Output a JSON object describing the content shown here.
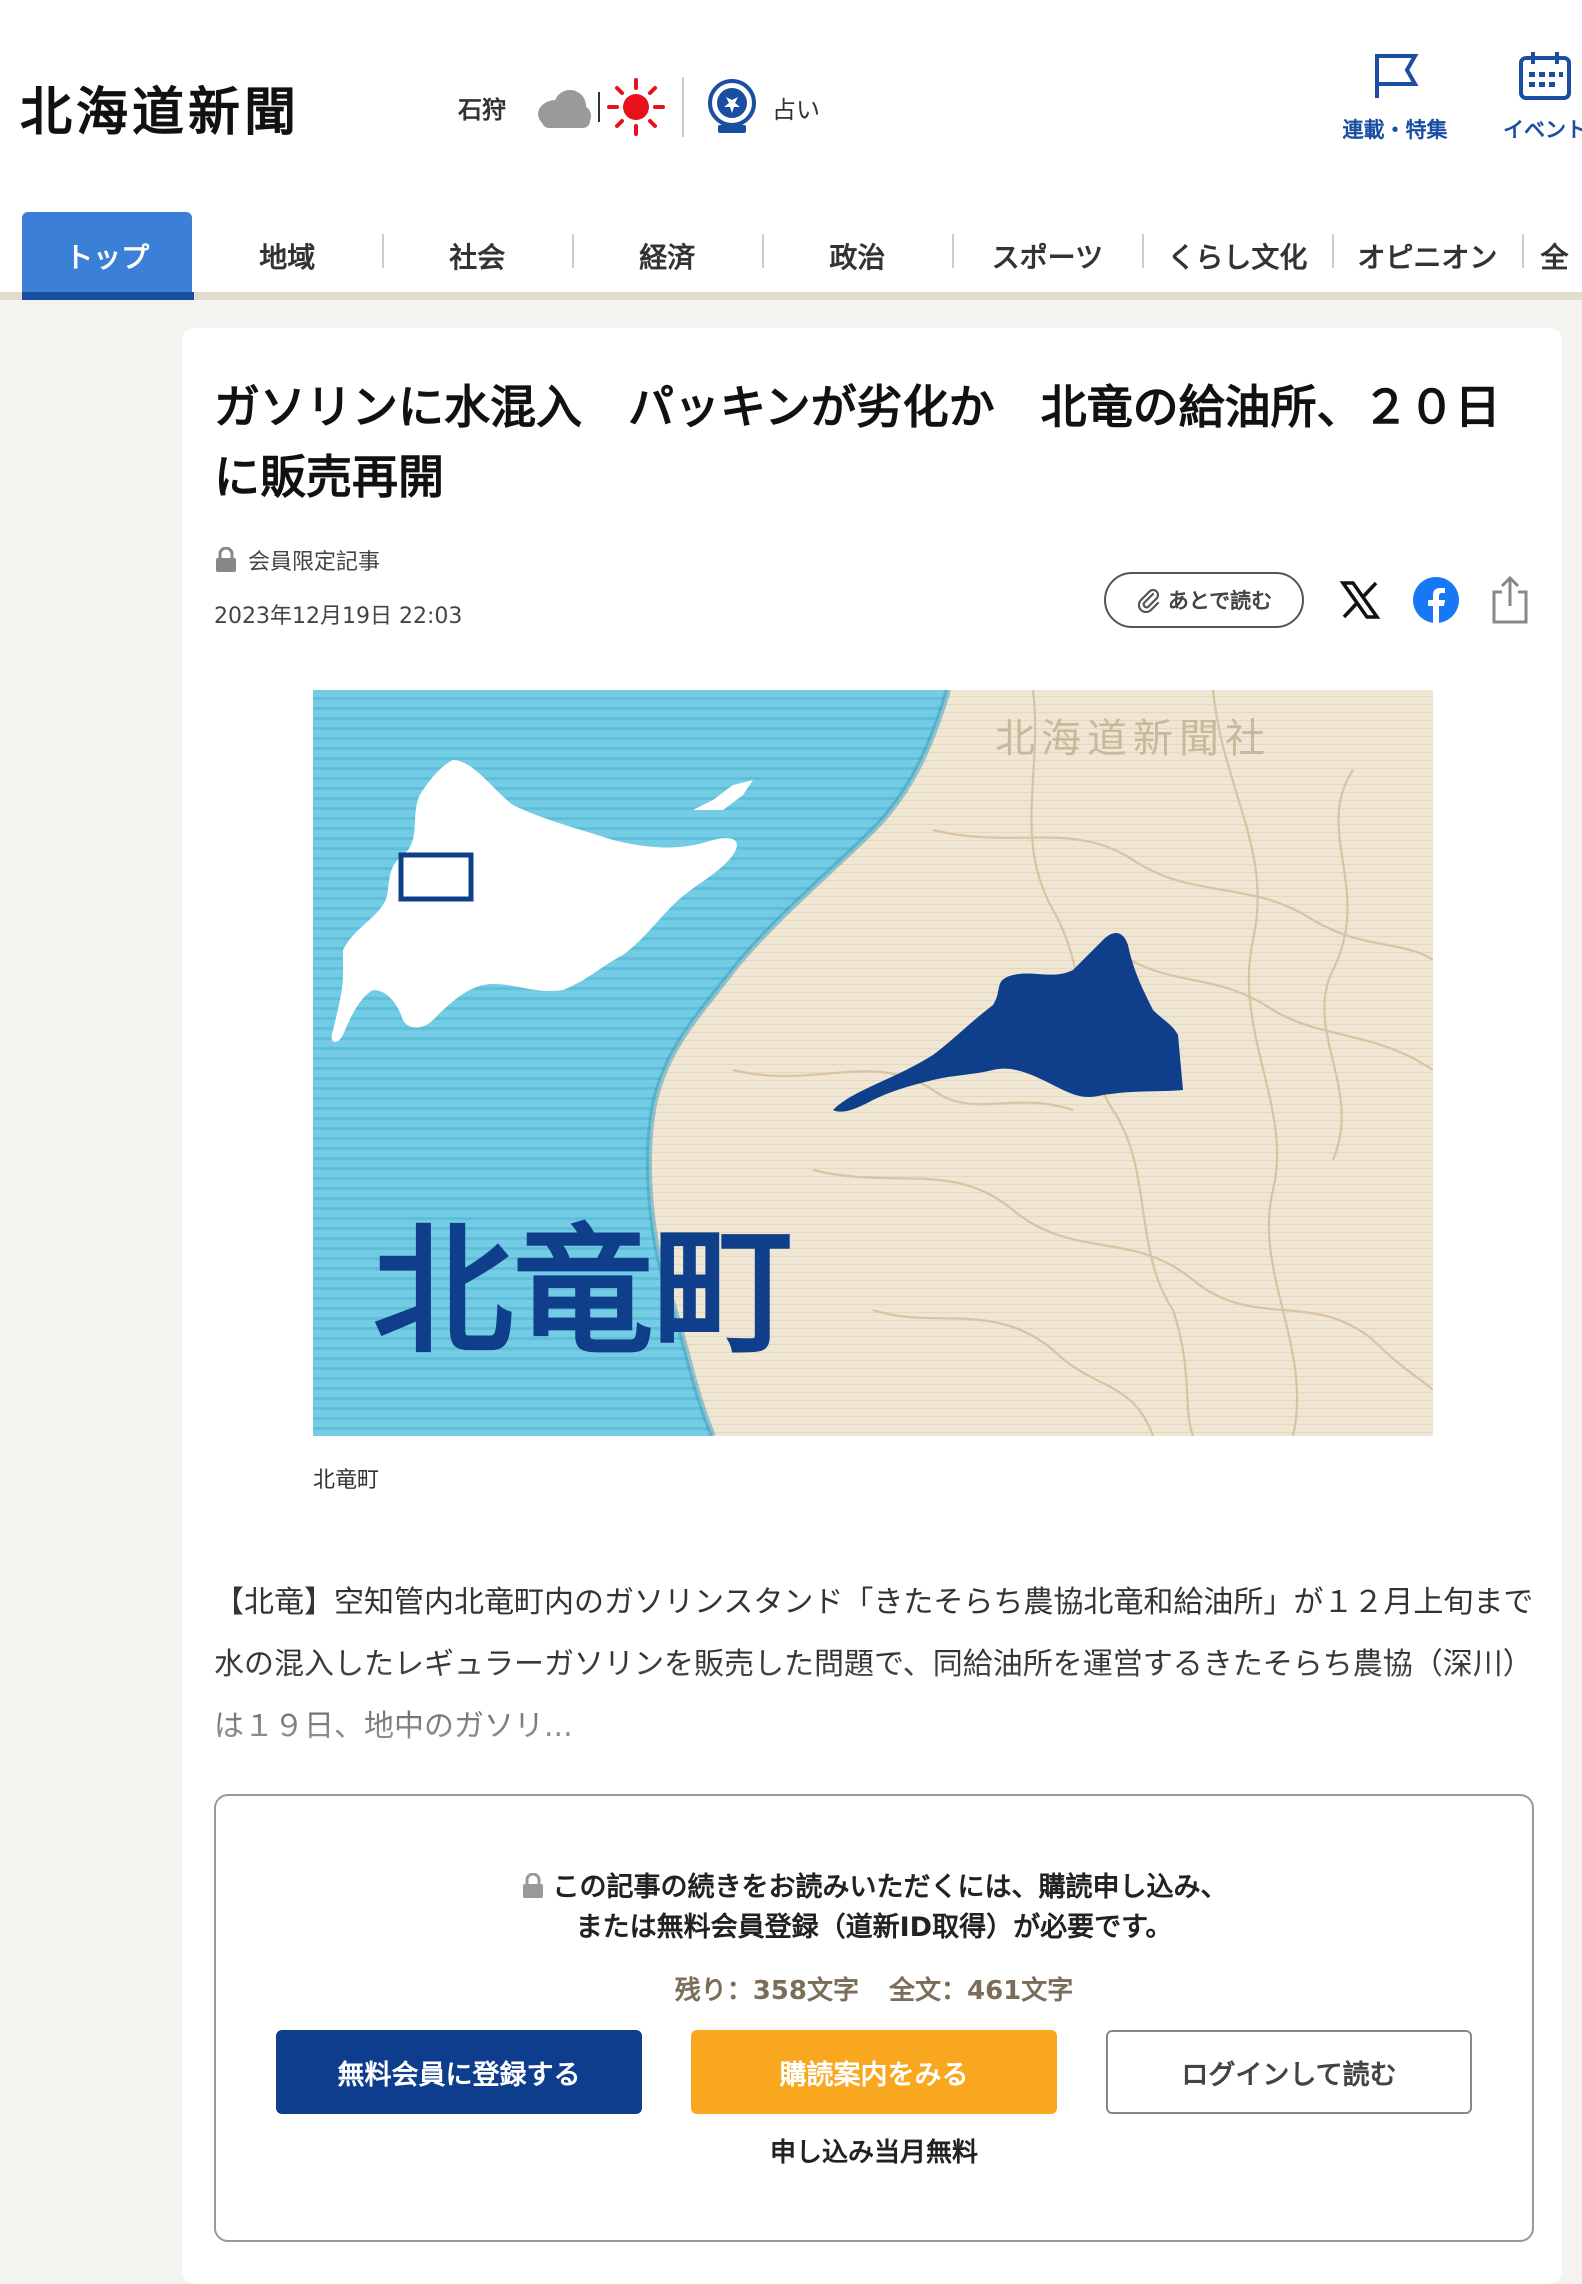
{
  "header": {
    "logo": "北海道新聞",
    "weather_city": "石狩",
    "fortune_label": "占い",
    "links": [
      {
        "label": "連載・特集",
        "icon": "flag-icon"
      },
      {
        "label": "イベント",
        "icon": "calendar-icon"
      }
    ]
  },
  "nav": {
    "items": [
      {
        "label": "トップ"
      },
      {
        "label": "地域"
      },
      {
        "label": "社会"
      },
      {
        "label": "経済"
      },
      {
        "label": "政治"
      },
      {
        "label": "スポーツ"
      },
      {
        "label": "くらし文化"
      },
      {
        "label": "オピニオン"
      },
      {
        "label": "全"
      }
    ],
    "active_index": 0
  },
  "article": {
    "title": "ガソリンに水混入　パッキンが劣化か　北竜の給油所、２０日に販売再開",
    "members_label": "会員限定記事",
    "date": "2023年12月19日 22:03",
    "read_later_label": "あとで読む",
    "image": {
      "big_label": "北竜町",
      "watermark": "北海道新聞社",
      "caption": "北竜町"
    },
    "body": "【北竜】空知管内北竜町内のガソリンスタンド「きたそらち農協北竜和給油所」が１２月上旬まで水の混入したレギュラーガソリンを販売した問題で、同給油所を運営するきたそらち農協（深川）は１９日、地中のガソリ..."
  },
  "paywall": {
    "message_line1": "この記事の続きをお読みいただくには、購読申し込み、",
    "message_line2": "または無料会員登録（道新ID取得）が必要です。",
    "remaining": "残り：358文字",
    "total": "全文：461文字",
    "register_label": "無料会員に登録する",
    "subscribe_label": "購読案内をみる",
    "login_label": "ログインして読む",
    "subscribe_note": "申し込み当月無料"
  },
  "colors": {
    "brand_blue": "#1a4ea1",
    "nav_active": "#3b7fd6",
    "register_button": "#0d3d8c",
    "subscribe_button": "#f8a71e",
    "map_sea": "#6cc9e3",
    "map_region": "#0f3f8a"
  }
}
